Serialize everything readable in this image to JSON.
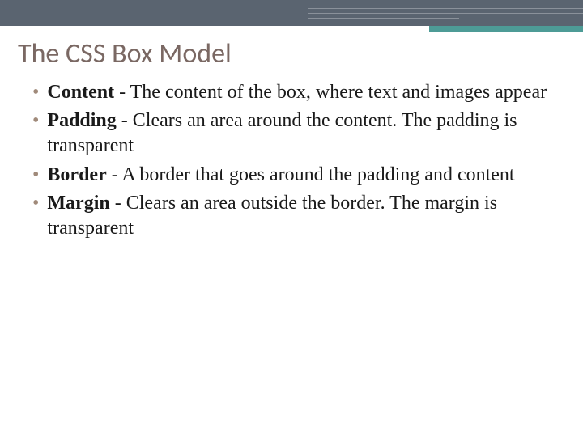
{
  "title": "The CSS Box Model",
  "bullets": [
    {
      "term": "Content",
      "desc": " - The content of the box, where text and images appear"
    },
    {
      "term": "Padding",
      "desc": " - Clears an area around the content. The padding is transparent"
    },
    {
      "term": "Border",
      "desc": " - A border that goes around the padding and content"
    },
    {
      "term": "Margin",
      "desc": " - Clears an area outside the border. The margin is transparent"
    }
  ]
}
